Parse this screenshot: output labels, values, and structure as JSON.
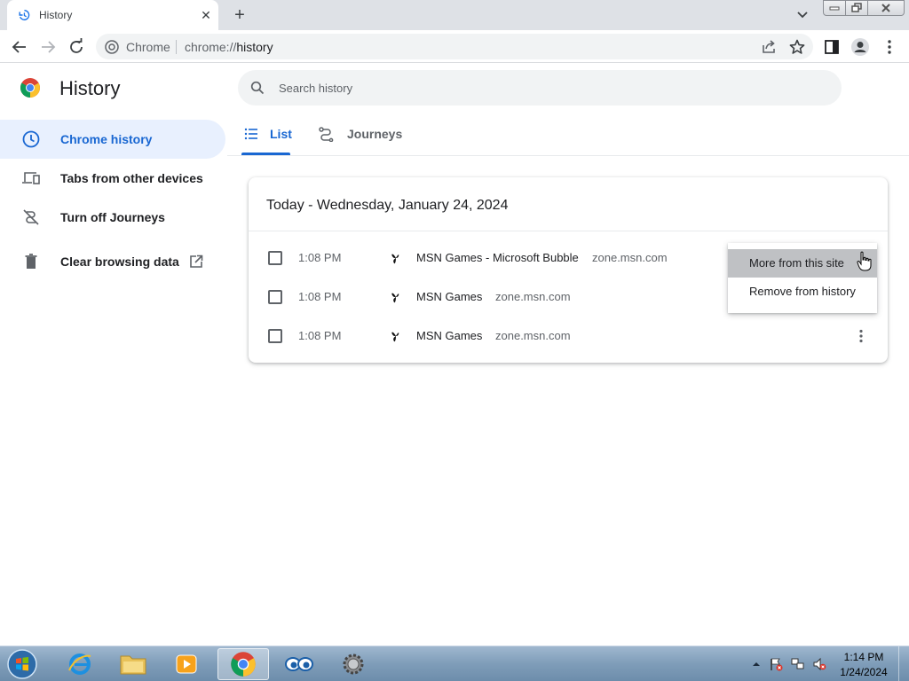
{
  "browser": {
    "tab_title": "History",
    "omnibox_chip": "Chrome",
    "url_scheme": "chrome://",
    "url_host": "history"
  },
  "page": {
    "title": "History"
  },
  "sidebar": {
    "items": [
      {
        "label": "Chrome history",
        "icon": "clock-icon",
        "active": true
      },
      {
        "label": "Tabs from other devices",
        "icon": "devices-icon",
        "active": false
      },
      {
        "label": "Turn off Journeys",
        "icon": "journeys-off-icon",
        "active": false
      },
      {
        "label": "Clear browsing data",
        "icon": "trash-icon",
        "active": false
      }
    ]
  },
  "search": {
    "placeholder": "Search history"
  },
  "tabs": [
    {
      "label": "List",
      "active": true
    },
    {
      "label": "Journeys",
      "active": false
    }
  ],
  "history": {
    "date_heading": "Today - Wednesday, January 24, 2024",
    "entries": [
      {
        "time": "1:08 PM",
        "title": "MSN Games - Microsoft Bubble",
        "domain": "zone.msn.com"
      },
      {
        "time": "1:08 PM",
        "title": "MSN Games",
        "domain": "zone.msn.com"
      },
      {
        "time": "1:08 PM",
        "title": "MSN Games",
        "domain": "zone.msn.com"
      }
    ]
  },
  "context_menu": {
    "items": [
      {
        "label": "More from this site",
        "hovered": true
      },
      {
        "label": "Remove from history",
        "hovered": false
      }
    ]
  },
  "taskbar": {
    "clock_time": "1:14 PM",
    "clock_date": "1/24/2024"
  },
  "colors": {
    "accent": "#1967d2",
    "active_bg": "#e8f0fe",
    "tabstrip": "#dee1e6"
  }
}
